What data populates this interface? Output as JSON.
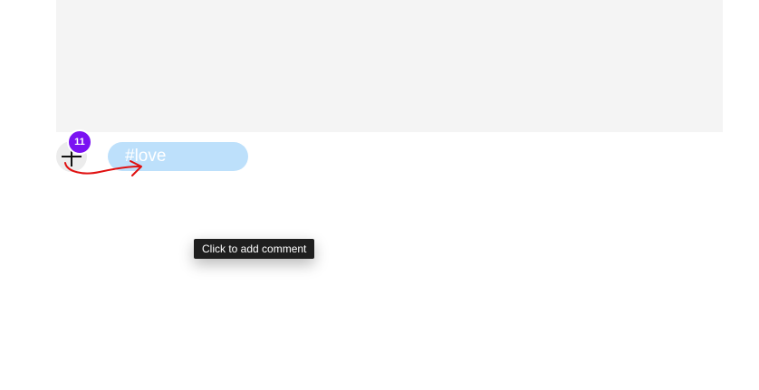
{
  "post": {
    "media_placeholder_color": "#f4f4f4"
  },
  "comment_control": {
    "icon": "plus-icon",
    "badge_count": "11",
    "badge_color": "#7a12f2"
  },
  "tag": {
    "label": "#love",
    "color": "#bde0fb"
  },
  "tooltip": {
    "text": "Click to add comment"
  },
  "annotation": {
    "icon": "red-curved-arrow-icon",
    "color": "#e01010"
  }
}
